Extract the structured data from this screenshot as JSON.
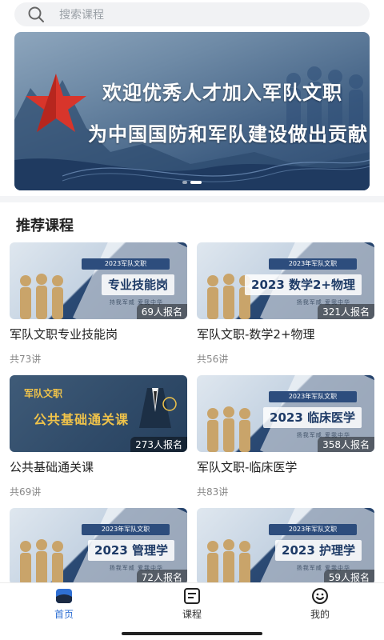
{
  "search": {
    "placeholder": "搜索课程"
  },
  "banner": {
    "line1": "欢迎优秀人才加入军队文职",
    "line2": "为中国国防和军队建设做出贡献",
    "slide_count": 2,
    "active_slide": 2
  },
  "recommended": {
    "title": "推荐课程",
    "courses": [
      {
        "name": "军队文职专业技能岗",
        "lessons": "共73讲",
        "enrolled": "69人报名",
        "thumb_title": "专业技能岗",
        "thumb_pill": "2023军队文职",
        "thumb_sub": "持我军威  爱我中华"
      },
      {
        "name": "军队文职-数学2+物理",
        "lessons": "共56讲",
        "enrolled": "321人报名",
        "thumb_title": "2023 数学2+物理",
        "thumb_pill": "2023年军队文职",
        "thumb_sub": "扬我军威  爱我中华"
      },
      {
        "name": "公共基础通关课",
        "lessons": "共69讲",
        "enrolled": "273人报名",
        "thumb_title": "公共基础通关课",
        "thumb_tag": "军队文职"
      },
      {
        "name": "军队文职-临床医学",
        "lessons": "共83讲",
        "enrolled": "358人报名",
        "thumb_title": "2023 临床医学",
        "thumb_pill": "2023年军队文职",
        "thumb_sub": "扬我军威  爱我中华"
      },
      {
        "name": "",
        "lessons": "",
        "enrolled": "72人报名",
        "thumb_title": "2023 管理学",
        "thumb_pill": "2023年军队文职",
        "thumb_sub": "扬我军威  爱我中华"
      },
      {
        "name": "",
        "lessons": "",
        "enrolled": "59人报名",
        "thumb_title": "2023 护理学",
        "thumb_pill": "2023年军队文职",
        "thumb_sub": "扬我军威  爱我中华"
      }
    ]
  },
  "tabbar": {
    "items": [
      {
        "label": "首页",
        "icon": "home-icon",
        "active": true
      },
      {
        "label": "课程",
        "icon": "course-icon",
        "active": false
      },
      {
        "label": "我的",
        "icon": "profile-icon",
        "active": false
      }
    ]
  },
  "colors": {
    "accent": "#2f6fd3",
    "navy": "#1f3b63",
    "gold": "#f0c34a"
  }
}
